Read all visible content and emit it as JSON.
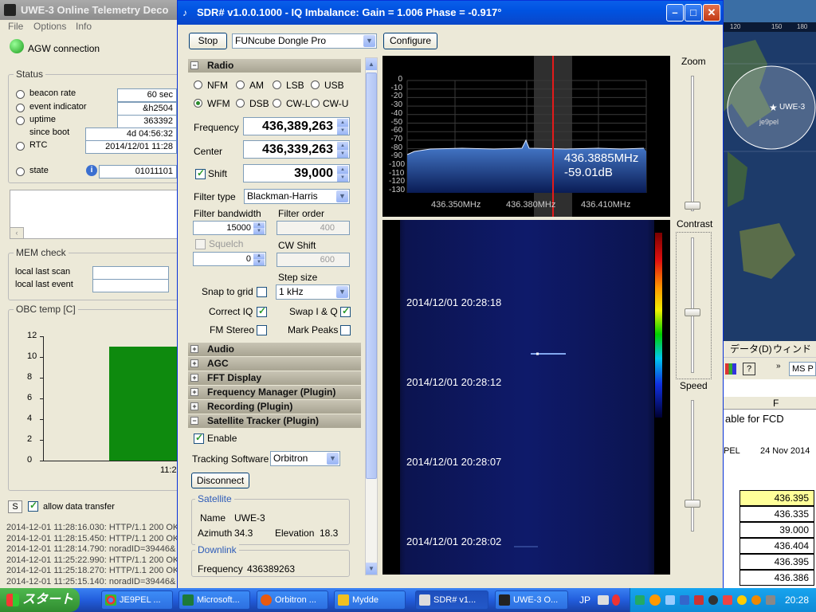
{
  "uwe": {
    "title": "UWE-3 Online Telemetry Deco",
    "menu": [
      "File",
      "Options",
      "Info"
    ],
    "agw": "AGW connection",
    "status_title": "Status",
    "beacon_rate_label": "beacon rate",
    "beacon_rate": "60 sec",
    "event_indicator_label": "event indicator",
    "event_indicator": "&h2504",
    "uptime_label": "uptime",
    "uptime": "363392",
    "since_boot_label": "since boot",
    "since_boot": "4d 04:56:32",
    "rtc_label": "RTC",
    "rtc": "2014/12/01 11:28",
    "state_label": "state",
    "state": "01011101",
    "mem_title": "MEM check",
    "local_last_scan": "local last scan",
    "local_last_event": "local last event",
    "obc_title": "OBC temp [C]",
    "obc_yticks": [
      "12",
      "10",
      "8",
      "6",
      "4",
      "2",
      "0"
    ],
    "obc_xtick": "11:2",
    "s_button": "S",
    "allow_transfer": "allow data transfer",
    "log": [
      "2014-12-01 11:28:16.030: HTTP/1.1 200 OK",
      "2014-12-01 11:28:15.450: HTTP/1.1 200 OK",
      "2014-12-01 11:28:14.790: noradID=39446&",
      "2014-12-01 11:25:22.990: HTTP/1.1 200 OK",
      "2014-12-01 11:25:18.270: HTTP/1.1 200 OK",
      "2014-12-01 11:25:15.140: noradID=39446&"
    ]
  },
  "sdr": {
    "title": "SDR# v1.0.0.1000 - IQ Imbalance: Gain = 1.006 Phase = -0.917°",
    "stop_button": "Stop",
    "device": "FUNcube Dongle Pro",
    "configure_button": "Configure",
    "radio_section": "Radio",
    "modes": [
      "NFM",
      "AM",
      "LSB",
      "USB",
      "WFM",
      "DSB",
      "CW-L",
      "CW-U"
    ],
    "selected_mode": "WFM",
    "frequency_label": "Frequency",
    "frequency": "436,389,263",
    "center_label": "Center",
    "center": "436,339,263",
    "shift_label": "Shift",
    "shift": "39,000",
    "filter_type_label": "Filter type",
    "filter_type": "Blackman-Harris",
    "filter_bandwidth_label": "Filter bandwidth",
    "filter_bandwidth": "15000",
    "filter_order_label": "Filter order",
    "filter_order": "400",
    "squelch_label": "Squelch",
    "squelch": "0",
    "cw_shift_label": "CW Shift",
    "cw_shift": "600",
    "step_size_label": "Step size",
    "step_size": "1 kHz",
    "snap_to_grid": "Snap to grid",
    "correct_iq": "Correct IQ",
    "swap_iq": "Swap I & Q",
    "fm_stereo": "FM Stereo",
    "mark_peaks": "Mark Peaks",
    "sections": [
      "Audio",
      "AGC",
      "FFT Display",
      "Frequency Manager (Plugin)",
      "Recording (Plugin)",
      "Satellite Tracker (Plugin)"
    ],
    "enable_label": "Enable",
    "tracking_software_label": "Tracking Software",
    "tracking_software": "Orbitron",
    "disconnect_button": "Disconnect",
    "satellite_group": "Satellite",
    "name_label": "Name",
    "sat_name": "UWE-3",
    "azimuth_label": "Azimuth",
    "azimuth": "34.3",
    "elevation_label": "Elevation",
    "elevation": "18.3",
    "downlink_group": "Downlink",
    "downlink_freq_label": "Frequency",
    "downlink_freq": "436389263",
    "fft_yticks": [
      "0",
      "-10",
      "-20",
      "-30",
      "-40",
      "-50",
      "-60",
      "-70",
      "-80",
      "-90",
      "-100",
      "-110",
      "-120",
      "-130"
    ],
    "fft_xticks": [
      "436.350MHz",
      "436.380MHz",
      "436.410MHz"
    ],
    "cursor_freq": "436.3885MHz",
    "cursor_db": "-59.01dB",
    "wf_times": [
      "2014/12/01 20:28:18",
      "2014/12/01 20:28:12",
      "2014/12/01 20:28:07",
      "2014/12/01 20:28:02"
    ],
    "zoom_label": "Zoom",
    "contrast_label": "Contrast",
    "speed_label": "Speed"
  },
  "map": {
    "ticks": [
      "120",
      "150",
      "180"
    ],
    "sat_label": "UWE-3",
    "station_label": "je9pel"
  },
  "excel": {
    "menu": [
      "データ(D)",
      "ウィンドウ("
    ],
    "font": "MS P",
    "col_header": "F",
    "caption": "able for FCD",
    "row_label": "PEL",
    "date": "24 Nov 2014",
    "values": [
      "436.395",
      "436.335",
      "39.000",
      "436.404",
      "436.395",
      "436.386"
    ]
  },
  "taskbar": {
    "start": "スタート",
    "tasks": [
      "JE9PEL ...",
      "Microsoft...",
      "Orbitron ...",
      "Mydde",
      "SDR# v1...",
      "UWE-3 O..."
    ],
    "ime": "JP",
    "clock": "20:28"
  }
}
